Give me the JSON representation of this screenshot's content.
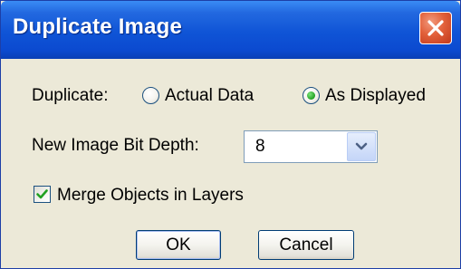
{
  "window": {
    "title": "Duplicate Image"
  },
  "duplicate": {
    "label": "Duplicate:",
    "options": [
      {
        "label": "Actual Data",
        "selected": false
      },
      {
        "label": "As Displayed",
        "selected": true
      }
    ]
  },
  "bit_depth": {
    "label": "New Image Bit Depth:",
    "value": "8"
  },
  "merge": {
    "label": "Merge Objects in Layers",
    "checked": true
  },
  "buttons": {
    "ok": "OK",
    "cancel": "Cancel"
  },
  "colors": {
    "titlebar": "#0b4ad0",
    "close": "#e2603a",
    "dialog_bg": "#ece9d8",
    "radio_dot": "#21a121",
    "check": "#21a121"
  },
  "icons": {
    "close": "close-icon",
    "dropdown": "chevron-down-icon",
    "check": "checkmark-icon"
  }
}
